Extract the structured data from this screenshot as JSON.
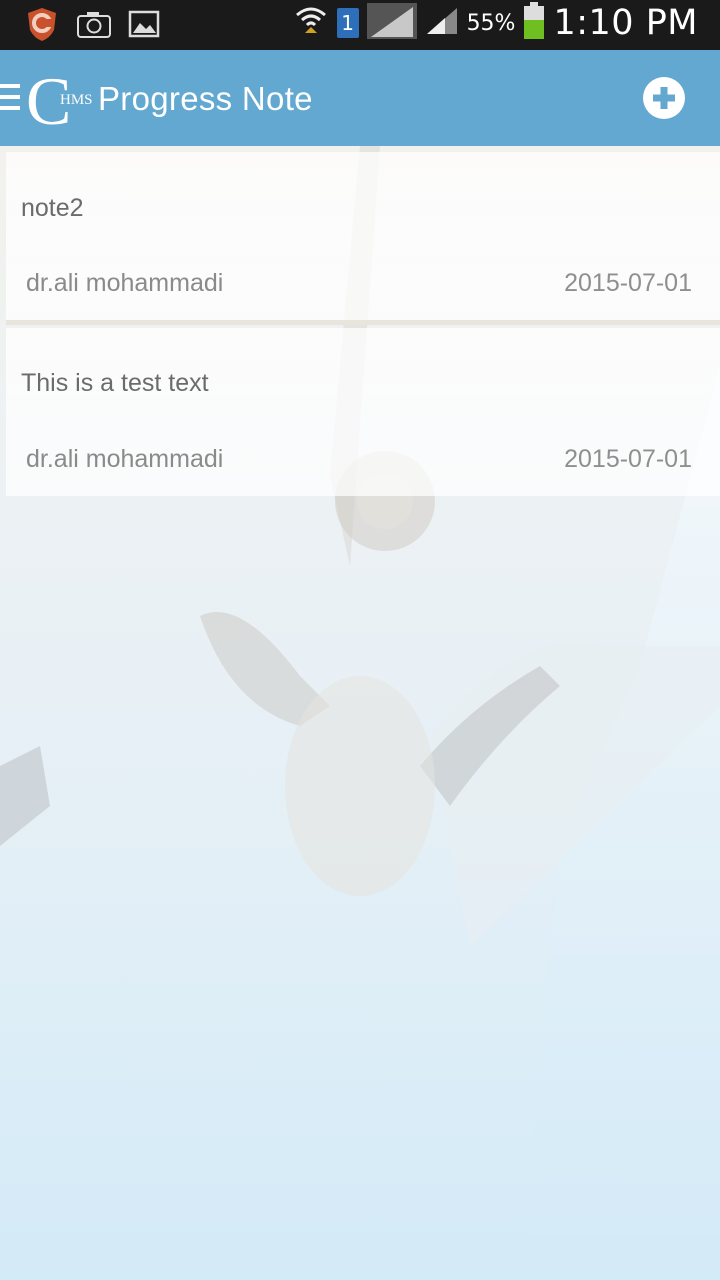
{
  "status_bar": {
    "battery_percent": "55%",
    "time": "1:10 PM",
    "sim_label": "1",
    "icons": [
      "shield-app-icon",
      "camera-icon",
      "gallery-icon",
      "wifi-icon",
      "sim-icon",
      "signal-icon",
      "signal-icon",
      "battery-icon"
    ]
  },
  "header": {
    "title": "Progress Note",
    "logo_text": "HMS",
    "logo_letter": "C",
    "accent_color": "#63a8d0"
  },
  "notes": [
    {
      "title": "note2",
      "author": "dr.ali mohammadi",
      "date": "2015-07-01"
    },
    {
      "title": "This is a test text",
      "author": "dr.ali mohammadi",
      "date": "2015-07-01"
    }
  ]
}
